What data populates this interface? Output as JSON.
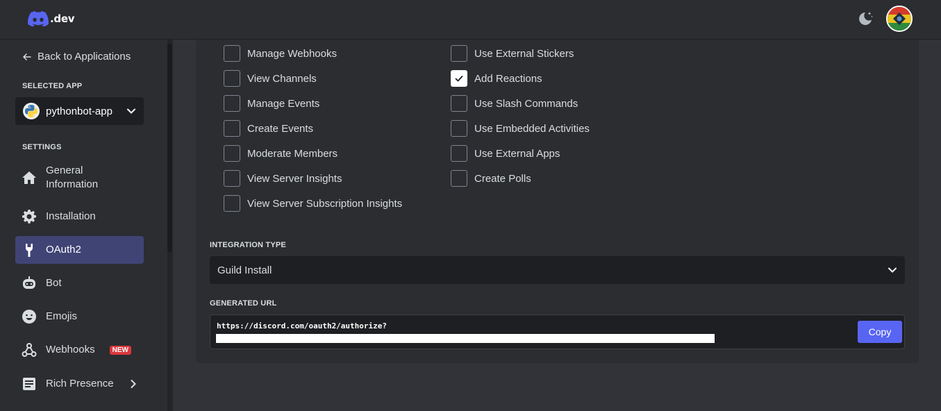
{
  "header": {
    "logo_text": ".dev",
    "theme_icon": "moon-stars-icon",
    "avatar_icon": "user-avatar"
  },
  "sidebar": {
    "back_label": "Back to Applications",
    "selected_app_label": "SELECTED APP",
    "app_name": "pythonbot-app",
    "settings_label": "SETTINGS",
    "items": [
      {
        "label": "General Information",
        "icon": "home-icon"
      },
      {
        "label": "Installation",
        "icon": "gear-icon"
      },
      {
        "label": "OAuth2",
        "icon": "wrench-icon",
        "active": true
      },
      {
        "label": "Bot",
        "icon": "bot-icon"
      },
      {
        "label": "Emojis",
        "icon": "emoji-icon"
      },
      {
        "label": "Webhooks",
        "icon": "webhook-icon",
        "badge": "NEW"
      },
      {
        "label": "Rich Presence",
        "icon": "document-icon"
      }
    ]
  },
  "permissions": {
    "column_left": [
      {
        "label": "Manage Webhooks",
        "checked": false
      },
      {
        "label": "View Channels",
        "checked": false
      },
      {
        "label": "Manage Events",
        "checked": false
      },
      {
        "label": "Create Events",
        "checked": false
      },
      {
        "label": "Moderate Members",
        "checked": false
      },
      {
        "label": "View Server Insights",
        "checked": false
      },
      {
        "label": "View Server Subscription Insights",
        "checked": false
      }
    ],
    "column_right": [
      {
        "label": "Use External Stickers",
        "checked": false
      },
      {
        "label": "Add Reactions",
        "checked": true
      },
      {
        "label": "Use Slash Commands",
        "checked": false
      },
      {
        "label": "Use Embedded Activities",
        "checked": false
      },
      {
        "label": "Use External Apps",
        "checked": false
      },
      {
        "label": "Create Polls",
        "checked": false
      }
    ]
  },
  "integration": {
    "label": "INTEGRATION TYPE",
    "value": "Guild Install"
  },
  "generated_url": {
    "label": "GENERATED URL",
    "url": "https://discord.com/oauth2/authorize?",
    "copy_label": "Copy"
  },
  "colors": {
    "accent": "#5865f2",
    "active_nav": "#404475",
    "badge": "#da373c"
  }
}
